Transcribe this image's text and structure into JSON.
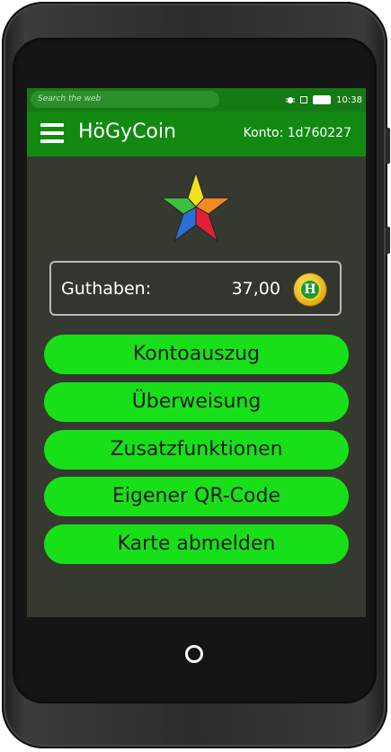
{
  "status_bar": {
    "search_placeholder": "Search the web",
    "time": "10:38",
    "icons": [
      "bug-icon",
      "signal-icon",
      "battery-icon"
    ]
  },
  "app_bar": {
    "title": "HöGyCoin",
    "account": "Konto: 1d760227",
    "menu_icon": "hamburger-icon"
  },
  "balance": {
    "label": "Guthaben:",
    "value": "37,00",
    "coin_letter": "H"
  },
  "menu": [
    {
      "label": "Kontoauszug"
    },
    {
      "label": "Überweisung"
    },
    {
      "label": "Zusatzfunktionen"
    },
    {
      "label": "Eigener QR-Code"
    },
    {
      "label": "Karte abmelden"
    }
  ],
  "colors": {
    "status_bar": "#157a15",
    "app_bar": "#128a12",
    "screen_bg": "#36392f",
    "button": "#18e018",
    "button_text": "#1b1b1b"
  }
}
